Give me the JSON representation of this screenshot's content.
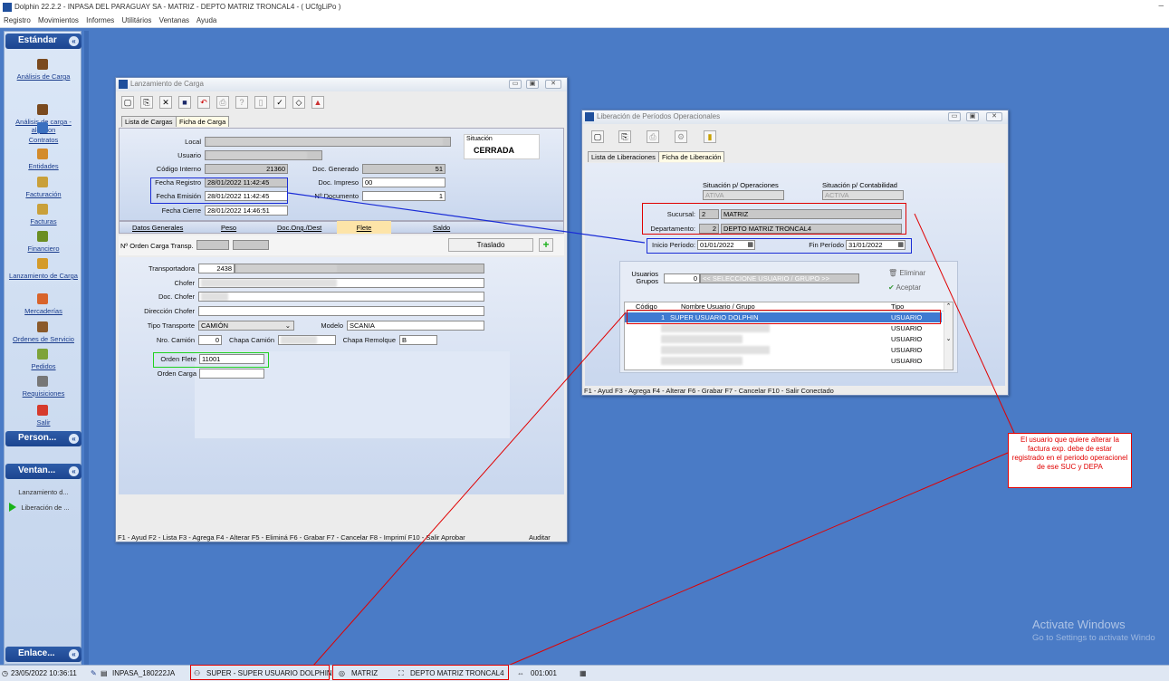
{
  "app": {
    "title": "Dolphin 22.2.2 - INPASA DEL PARAGUAY SA - MATRIZ - DEPTO MATRIZ TRONCAL4 -  ( UCfgLiPo )"
  },
  "menu": [
    "Registro",
    "Movimientos",
    "Informes",
    "Utilitários",
    "Ventanas",
    "Ayuda"
  ],
  "sidebar": {
    "standard_label": "Estándar",
    "items": [
      {
        "label": "Análisis de Carga",
        "icon": "sack-icon",
        "color": "#7a4a1f"
      },
      {
        "label": "Análisis de carga - algodon",
        "icon": "sack-icon",
        "color": "#7a4a1f"
      },
      {
        "label": "Contratos",
        "icon": "monitor-icon",
        "color": "#3a70c0"
      },
      {
        "label": "Entidades",
        "icon": "people-icon",
        "color": "#d38b2c"
      },
      {
        "label": "Facturación",
        "icon": "money-bag-icon",
        "color": "#c9a03a"
      },
      {
        "label": "Facturas",
        "icon": "money-bag-icon",
        "color": "#c9a03a"
      },
      {
        "label": "Financiero",
        "icon": "money-bag-icon",
        "color": "#6b8e23"
      },
      {
        "label": "Lanzamiento de Carga",
        "icon": "truck-icon",
        "color": "#d49b2a"
      },
      {
        "label": "Mercaderías",
        "icon": "box-icon",
        "color": "#d8642b"
      },
      {
        "label": "Ordenes de Servicio",
        "icon": "clipboard-icon",
        "color": "#8a5a2b"
      },
      {
        "label": "Pedidos",
        "icon": "pencil-icon",
        "color": "#7da33a"
      },
      {
        "label": "Requisiciones",
        "icon": "check-icon",
        "color": "#777"
      },
      {
        "label": "Salir",
        "icon": "exit-icon",
        "color": "#d63a2c"
      }
    ],
    "personal_label": "Person...",
    "windows_label": "Ventan...",
    "window_items": [
      "Lanzamiento d...",
      "Liberación de ..."
    ],
    "links_label": "Enlace..."
  },
  "carga": {
    "title": "Lanzamiento de Carga",
    "tabs": [
      "Lista de Cargas",
      "Ficha de Carga"
    ],
    "labels": {
      "local": "Local",
      "usuario": "Usuario",
      "codigo": "Código Interno",
      "fecha_registro": "Fecha Registro",
      "fecha_emision": "Fecha Emisión",
      "fecha_cierre": "Fecha Cierre",
      "doc_generado": "Doc. Generado",
      "doc_impreso": "Doc. Impreso",
      "nro_documento": "Nº Documento",
      "situacion": "Situación"
    },
    "values": {
      "codigo": "21360",
      "fecha_registro": "28/01/2022 11:42:45",
      "fecha_emision": "28/01/2022 11:42:45",
      "fecha_cierre": "28/01/2022 14:46:51",
      "doc_generado": "51",
      "doc_impreso": "00",
      "nro_documento": "1",
      "situacion": "CERRADA"
    },
    "subtabs": [
      "Datos Generales",
      "Peso",
      "Doc.Ong./Dest",
      "Flete",
      "Saldo"
    ],
    "orden_carga_transp": "Nº Orden Carga Transp.",
    "traslado": "Traslado",
    "flete_labels": {
      "transportadora": "Transportadora",
      "chofer": "Chofer",
      "doc_chofer": "Doc. Chofer",
      "direccion": "Dirección Chofer",
      "tipo_transporte": "Tipo Transporte",
      "modelo": "Modelo",
      "nro_camion": "Nro. Camión",
      "chapa_camion": "Chapa Camión",
      "chapa_remolque": "Chapa Remolque",
      "orden_flete": "Orden Flete",
      "orden_carga": "Orden Carga"
    },
    "flete_values": {
      "transportadora": "2438",
      "tipo_transporte": "CAMIÓN",
      "modelo": "SCANIA",
      "nro_camion": "0",
      "chapa_remolque": "B",
      "orden_flete": "11001"
    },
    "status": "F1 - Ayud  F2 - Lista  F3 - Agrega F4 - Alterar  F5 - Eliminá F6 - Grabar  F7 - Cancelar  F8 - Imprimí  F10 - Salir Aprobar",
    "auditar": "Auditar"
  },
  "liberacion": {
    "title": "Liberación de Períodos Operacionales",
    "tabs": [
      "Lista de Liberaciones",
      "Ficha de Liberación"
    ],
    "sit_operaciones_label": "Situación p/ Operaciones",
    "sit_operaciones": "ATIVA",
    "sit_contabilidad_label": "Situación p/ Contabilidad",
    "sit_contabilidad": "ACTIVA",
    "sucursal_label": "Sucursal:",
    "sucursal_code": "2",
    "sucursal_name": "MATRIZ",
    "departamento_label": "Departamento:",
    "departamento_code": "2",
    "departamento_name": "DEPTO MATRIZ TRONCAL4",
    "inicio_label": "Inicio Período:",
    "inicio": "01/01/2022",
    "fin_label": "Fin Período",
    "fin": "31/01/2022",
    "usuarios_label": "Usuarios Grupos",
    "usuario_code": "0",
    "usuario_placeholder": "<< SELECCIONE USUARIO / GRUPO >>",
    "eliminar": "Eliminar",
    "aceptar": "Aceptar",
    "cols": [
      "Código",
      "Nombre Usuario / Grupo",
      "Tipo"
    ],
    "rows": [
      {
        "code": "1",
        "name": "SUPER USUARIO DOLPHIN",
        "tipo": "USUARIO"
      },
      {
        "code": "",
        "name": "",
        "tipo": "USUARIO"
      },
      {
        "code": "",
        "name": "",
        "tipo": "USUARIO"
      },
      {
        "code": "",
        "name": "",
        "tipo": "USUARIO"
      },
      {
        "code": "",
        "name": "",
        "tipo": "USUARIO"
      }
    ],
    "status": "F1 - Ayud  F3 - Agrega F4 - Alterar  F6 - Grabar  F7 - Cancelar  F10 - Salir Conectado"
  },
  "annotation": "El usuario que quiere alterar la factura exp. debe de estar registrado en el periodo operacionel de ese SUC y DEPA",
  "activate": {
    "title": "Activate Windows",
    "subtitle": "Go to Settings to activate Windo"
  },
  "bottom": {
    "datetime": "23/05/2022 10:36:11",
    "db": "INPASA_180222JA",
    "user": "SUPER - SUPER USUARIO DOLPHIN",
    "sucursal": "MATRIZ",
    "depto": "DEPTO MATRIZ TRONCAL4",
    "code": "001:001"
  }
}
